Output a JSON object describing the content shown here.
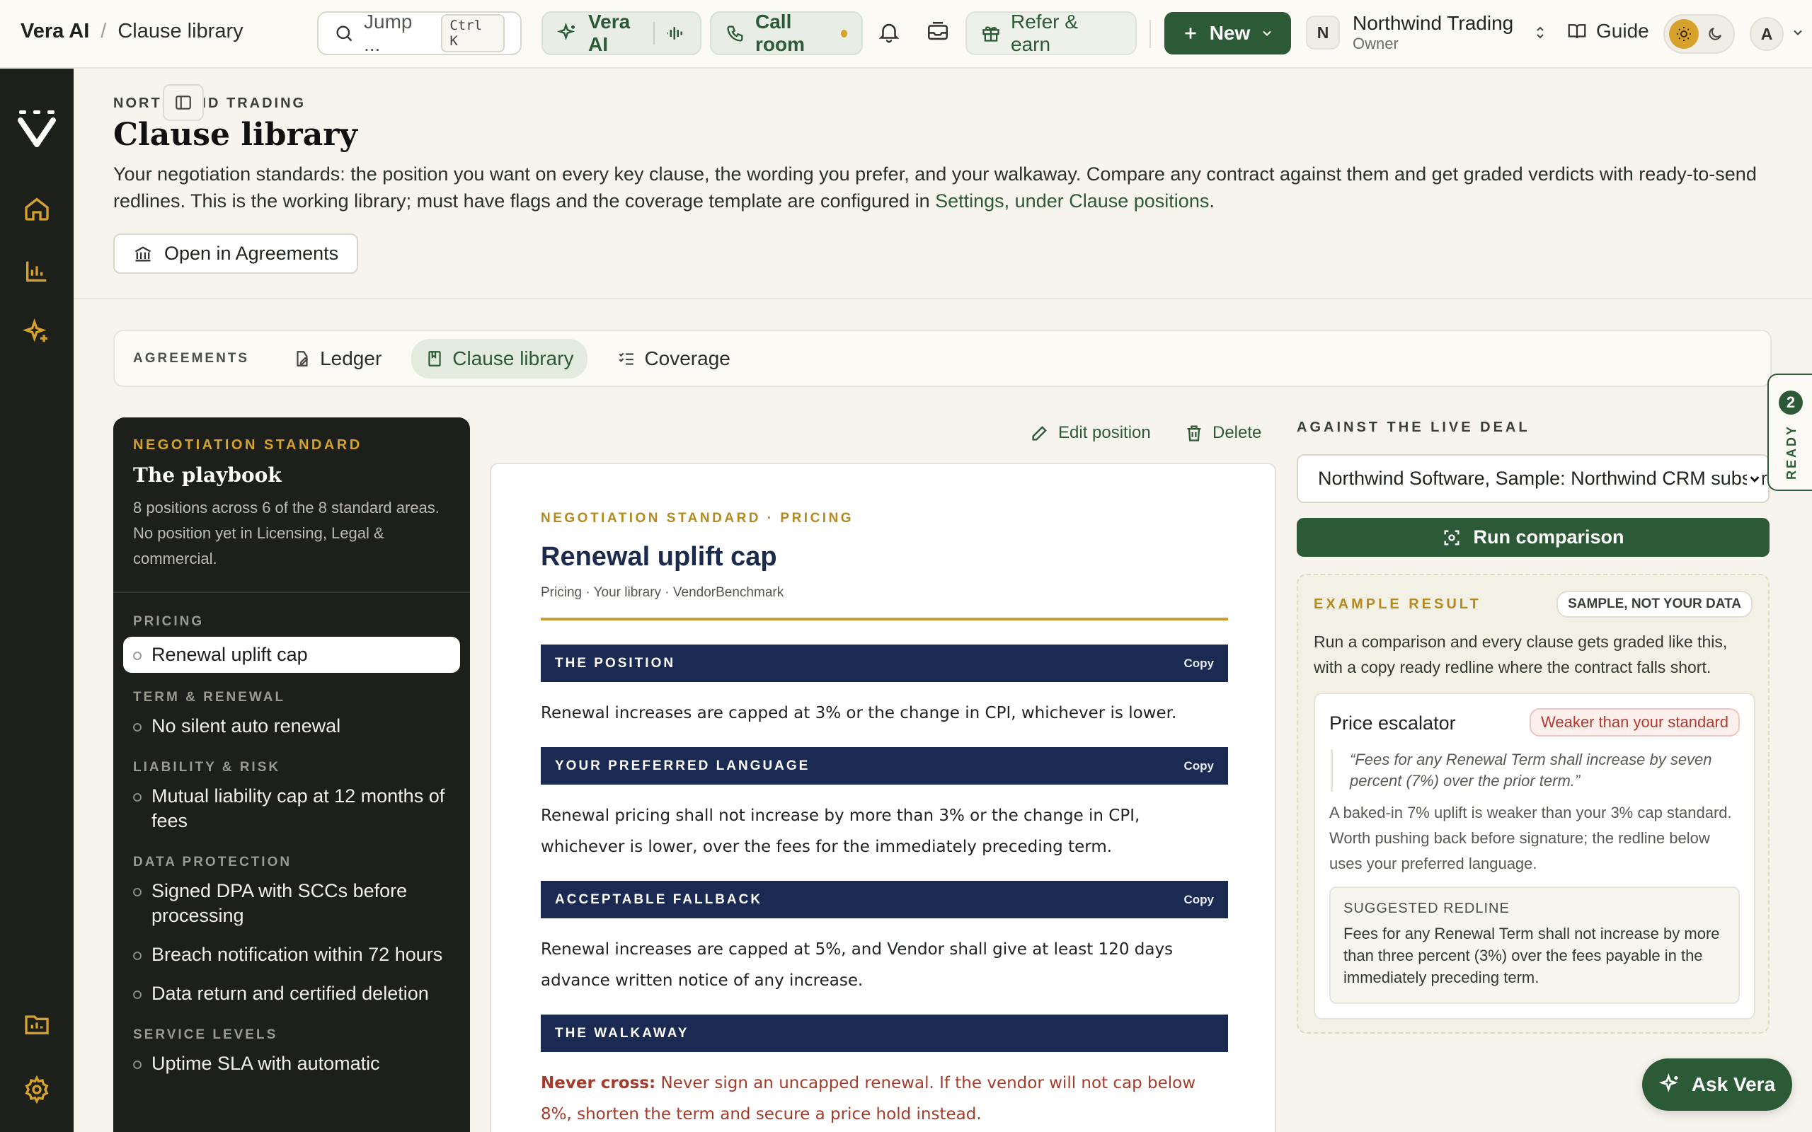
{
  "topbar": {
    "app_name": "Vera AI",
    "crumb_sep": "/",
    "page_name": "Clause library",
    "search_placeholder": "Jump ...",
    "search_shortcut": "Ctrl K",
    "vera_ai_label": "Vera AI",
    "call_room_label": "Call room",
    "refer_label": "Refer & earn",
    "new_label": "New",
    "org_initial": "N",
    "org_name": "Northwind Trading",
    "org_role": "Owner",
    "guide_label": "Guide",
    "user_initial": "A"
  },
  "header": {
    "eyebrow": "NORTHWIND TRADING",
    "title": "Clause library",
    "description": "Your negotiation standards: the position you want on every key clause, the wording you prefer, and your walkaway. Compare any contract against them and get graded verdicts with ready-to-send redlines. This is the working library; must have flags and the coverage template are configured in ",
    "description_link": "Settings, under Clause positions",
    "description_end": ".",
    "open_agreements_label": "Open in Agreements"
  },
  "tabs": {
    "label": "AGREEMENTS",
    "items": [
      {
        "label": "Ledger"
      },
      {
        "label": "Clause library"
      },
      {
        "label": "Coverage"
      }
    ]
  },
  "playbook": {
    "eyebrow": "NEGOTIATION STANDARD",
    "title": "The playbook",
    "description": "8 positions across 6 of the 8 standard areas. No position yet in Licensing, Legal & commercial.",
    "groups": [
      {
        "name": "PRICING",
        "items": [
          "Renewal uplift cap"
        ]
      },
      {
        "name": "TERM & RENEWAL",
        "items": [
          "No silent auto renewal"
        ]
      },
      {
        "name": "LIABILITY & RISK",
        "items": [
          "Mutual liability cap at 12 months of fees"
        ]
      },
      {
        "name": "DATA PROTECTION",
        "items": [
          "Signed DPA with SCCs before processing",
          "Breach notification within 72 hours",
          "Data return and certified deletion"
        ]
      },
      {
        "name": "SERVICE LEVELS",
        "items": [
          "Uptime SLA with automatic"
        ]
      }
    ]
  },
  "actions": {
    "edit_label": "Edit position",
    "delete_label": "Delete"
  },
  "document": {
    "eyebrow": "NEGOTIATION STANDARD · PRICING",
    "title": "Renewal uplift cap",
    "meta": "Pricing · Your library · VendorBenchmark",
    "copy_label": "Copy",
    "sections": [
      {
        "heading": "THE POSITION",
        "body": "Renewal increases are capped at 3% or the change in CPI, whichever is lower."
      },
      {
        "heading": "YOUR PREFERRED LANGUAGE",
        "body": "Renewal pricing shall not increase by more than 3% or the change in CPI, whichever is lower, over the fees for the immediately preceding term."
      },
      {
        "heading": "ACCEPTABLE FALLBACK",
        "body": "Renewal increases are capped at 5%, and Vendor shall give at least 120 days advance written notice of any increase."
      },
      {
        "heading": "THE WALKAWAY",
        "never_label": "Never cross:",
        "body": "Never sign an uncapped renewal. If the vendor will not cap below 8%, shorten the term and secure a price hold instead."
      }
    ]
  },
  "live_deal": {
    "eyebrow": "AGAINST THE LIVE DEAL",
    "selected_deal": "Northwind Software, Sample: Northwind CRM subscription",
    "run_label": "Run comparison"
  },
  "example": {
    "eyebrow": "EXAMPLE RESULT",
    "badge": "SAMPLE, NOT YOUR DATA",
    "description": "Run a comparison and every clause gets graded like this, with a copy ready redline where the contract falls short.",
    "clause": "Price escalator",
    "verdict": "Weaker than your standard",
    "quote": "“Fees for any Renewal Term shall increase by seven percent (7%) over the prior term.”",
    "analysis": "A baked-in 7% uplift is weaker than your 3% cap standard. Worth pushing back before signature; the redline below uses your preferred language.",
    "redline_label": "SUGGESTED REDLINE",
    "redline_text": "Fees for any Renewal Term shall not increase by more than three percent (3%) over the fees payable in the immediately preceding term."
  },
  "ready": {
    "count": "2",
    "label": "READY"
  },
  "ask_vera_label": "Ask Vera",
  "colors": {
    "brand_green": "#2d5a36",
    "accent_gold": "#d6a22c",
    "navy": "#1b2a52",
    "rail_dark": "#1c1f1a"
  }
}
